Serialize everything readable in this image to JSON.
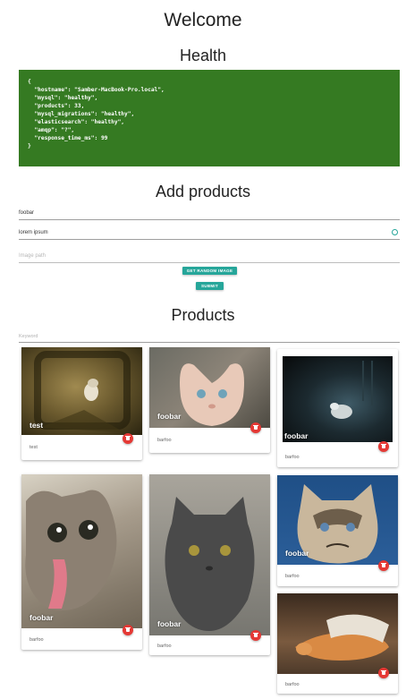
{
  "page": {
    "title": "Welcome",
    "health_heading": "Health",
    "health_json": "{\n  \"hostname\": \"Samber-MacBook-Pro.local\",\n  \"mysql\": \"healthy\",\n  \"products\": 33,\n  \"mysql_migrations\": \"healthy\",\n  \"elasticsearch\": \"healthy\",\n  \"amqp\": \"?\",\n  \"response_time_ms\": 99\n}",
    "add_heading": "Add products",
    "products_heading": "Products"
  },
  "form": {
    "name_value": "foobar",
    "description_value": "lorem ipsum",
    "image_placeholder": "Image path",
    "random_image_label": "GET RANDOM IMAGE",
    "submit_label": "SUBMIT"
  },
  "search": {
    "placeholder": "Keyword"
  },
  "colors": {
    "health_bg": "#357a22",
    "accent": "#26a69a",
    "delete": "#e53935"
  },
  "icons": {
    "delete": "trash-icon",
    "valid": "check-circle-icon"
  },
  "products": [
    {
      "title": "test",
      "description": "test"
    },
    {
      "title": "foobar",
      "description": "barfoo"
    },
    {
      "title": "foobar",
      "description": "barfoo"
    },
    {
      "title": "foobar",
      "description": "barfoo"
    },
    {
      "title": "foobar",
      "description": "barfoo"
    },
    {
      "title": "foobar",
      "description": "barfoo"
    },
    {
      "title": "",
      "description": "barfoo"
    }
  ]
}
